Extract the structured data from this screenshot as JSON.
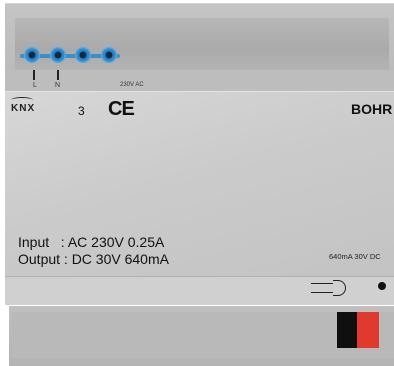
{
  "terminals_top": {
    "label_l": "L",
    "label_n": "N",
    "voltage_label": "230V AC"
  },
  "face": {
    "logo_text": "KNX",
    "number": "3",
    "ce_mark": "CE",
    "brand": "BOHR",
    "input_line": "Input   : AC 230V 0.25A",
    "output_line": "Output : DC 30V 640mA",
    "side_label": "640mA 30V DC"
  },
  "colors": {
    "screw_blue": "#2f86c7",
    "terminal_black": "#0f0f0f",
    "terminal_red": "#e03a2e"
  }
}
